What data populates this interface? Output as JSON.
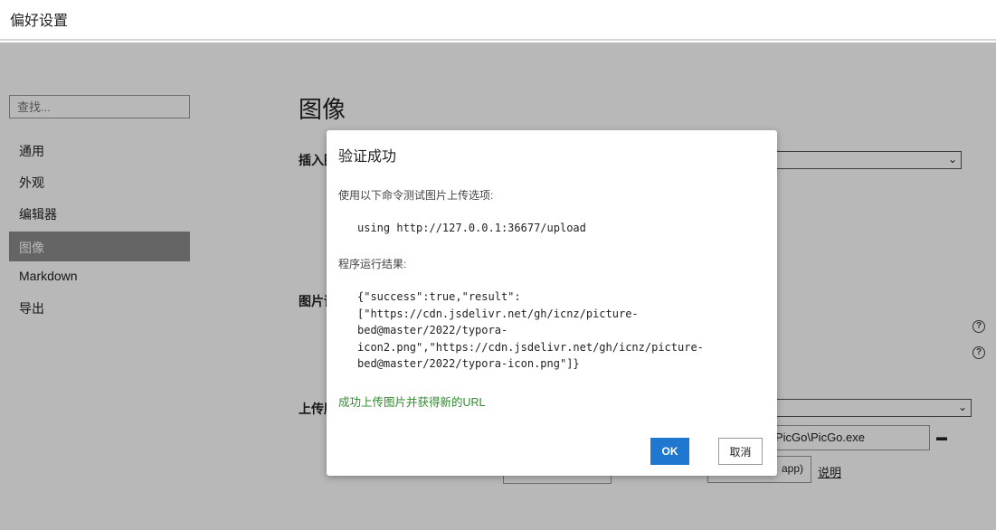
{
  "window": {
    "title": "偏好设置"
  },
  "sidebar": {
    "search_placeholder": "查找...",
    "items": [
      {
        "label": "通用"
      },
      {
        "label": "外观"
      },
      {
        "label": "编辑器"
      },
      {
        "label": "图像",
        "active": true
      },
      {
        "label": "Markdown"
      },
      {
        "label": "导出"
      }
    ]
  },
  "main": {
    "title": "图像",
    "insert_label_partial": "插入图",
    "image_label_partial": "图片语",
    "upload_label_partial": "上传服",
    "picgo_path_partial": "PicGo\\PicGo.exe",
    "app_btn_partial": "app)",
    "explain_link": "说明"
  },
  "dialog": {
    "title": "验证成功",
    "instruction": "使用以下命令测试图片上传选项:",
    "command": "using http://127.0.0.1:36677/upload",
    "result_label": "程序运行结果:",
    "result_lines": [
      "{\"success\":true,\"result\":",
      "[\"https://cdn.jsdelivr.net/gh/icnz/picture-",
      "bed@master/2022/typora-",
      "icon2.png\",\"https://cdn.jsdelivr.net/gh/icnz/picture-",
      "bed@master/2022/typora-icon.png\"]}"
    ],
    "success_message": "成功上传图片并获得新的URL",
    "ok_label": "OK",
    "cancel_label": "取消"
  },
  "colors": {
    "accent": "#1f77d0",
    "success_text": "#2e8b2e",
    "sidebar_active": "#8c8c8c"
  }
}
